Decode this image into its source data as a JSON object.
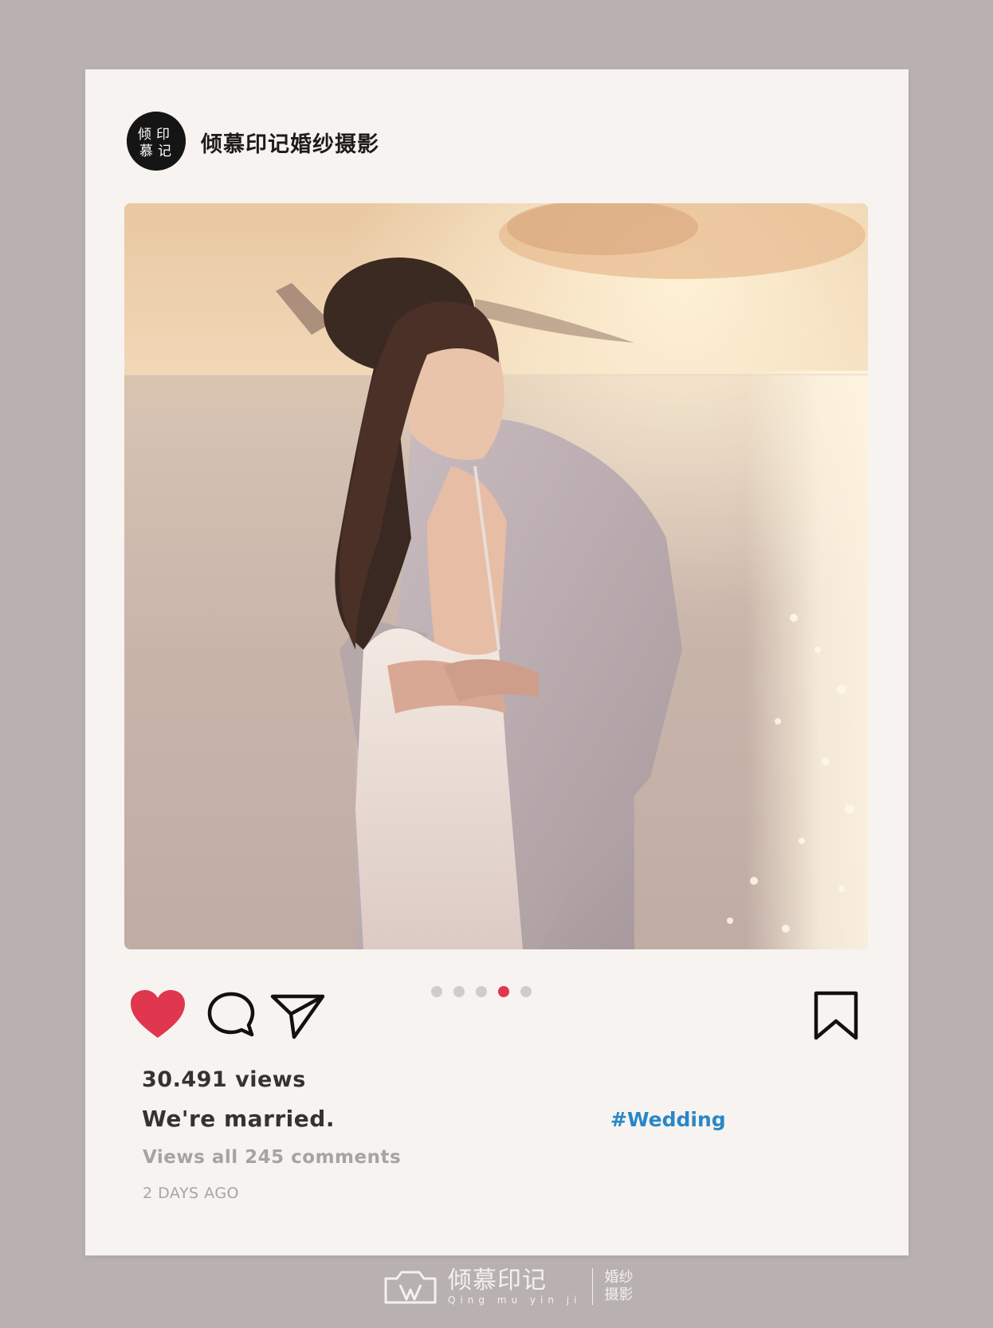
{
  "profile": {
    "name": "倾慕印记婚纱摄影",
    "avatar_chars": [
      "倾",
      "慕",
      "印",
      "记"
    ]
  },
  "carousel": {
    "count": 5,
    "active_index": 3
  },
  "stats": {
    "views": "30.491 views",
    "caption": "We're married.",
    "hashtag": "#Wedding",
    "comments": "Views all 245 comments",
    "time": "2 DAYS AGO"
  },
  "icons": {
    "like": "heart-icon",
    "comment": "comment-bubble-icon",
    "share": "send-icon",
    "save": "bookmark-icon"
  },
  "colors": {
    "background": "#b9b1b1",
    "card": "#f6f3f0",
    "like": "#e0364e",
    "hashtag": "#2a86c6",
    "active_dot": "#e0364e"
  },
  "footer": {
    "brand": "倾慕印记",
    "pinyin": "Qing mu yin ji",
    "tag_line1": "婚纱",
    "tag_line2": "摄影"
  }
}
